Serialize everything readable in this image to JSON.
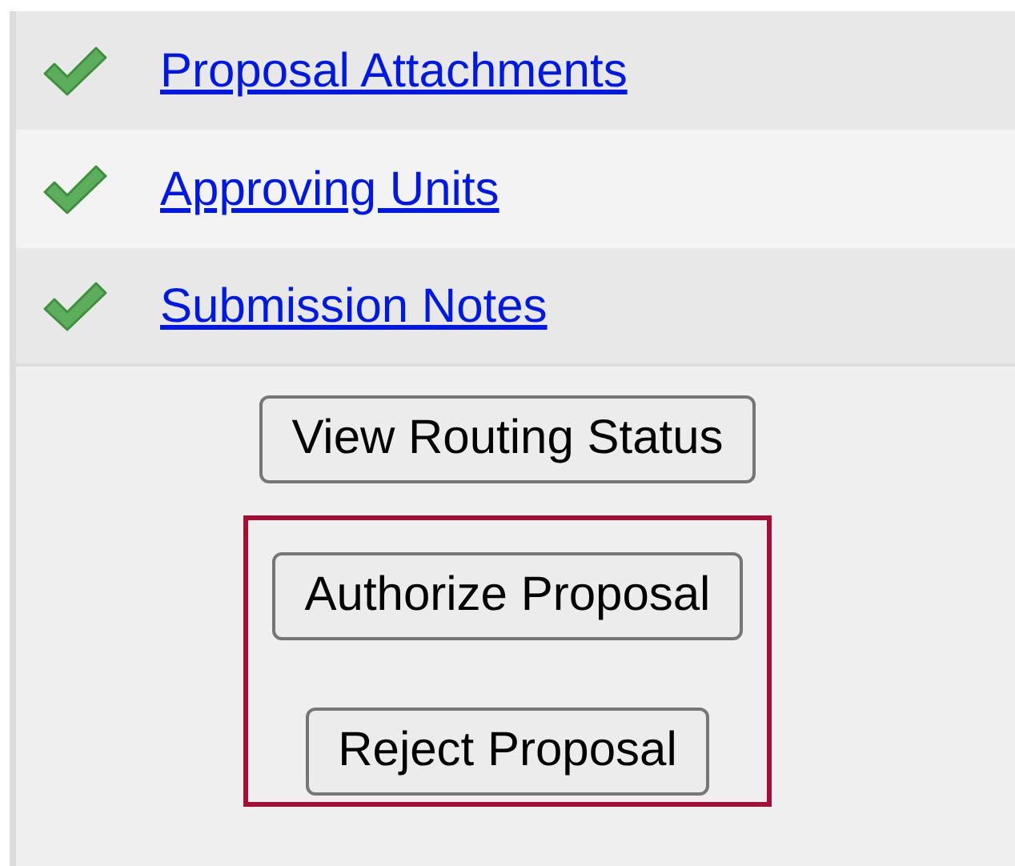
{
  "sections": [
    {
      "label": "Proposal Attachments",
      "completed": true
    },
    {
      "label": "Approving Units",
      "completed": true
    },
    {
      "label": "Submission Notes",
      "completed": true
    }
  ],
  "routing_button": "View Routing Status",
  "action_buttons": [
    "Authorize Proposal",
    "Reject Proposal"
  ]
}
